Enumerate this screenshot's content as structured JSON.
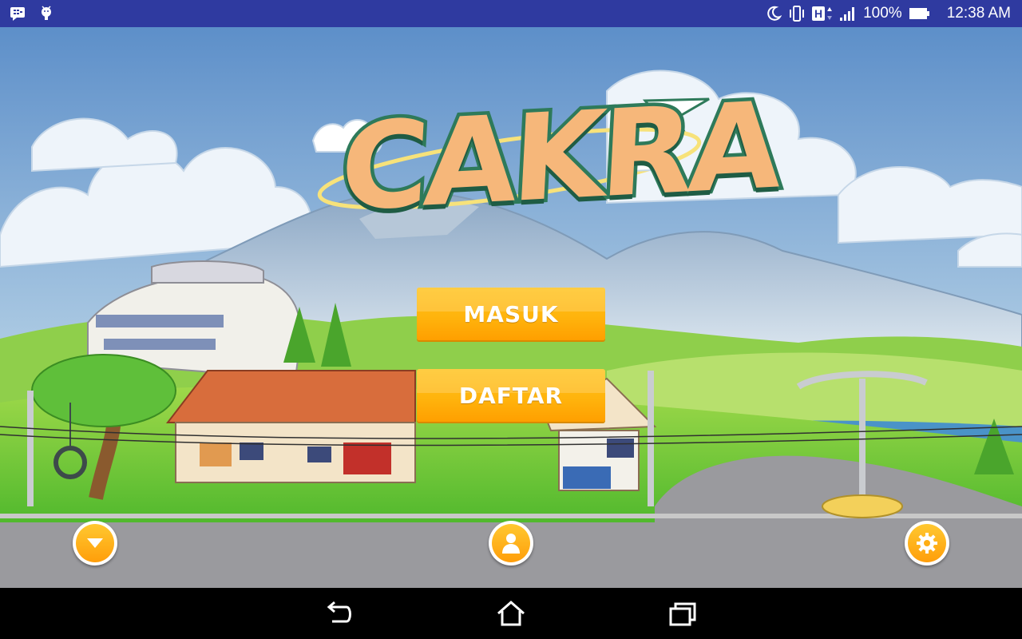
{
  "status_bar": {
    "battery_percent": "100%",
    "time": "12:38 AM",
    "network_type": "H",
    "icons": [
      "bbm-icon",
      "android-debug-icon",
      "moon-icon",
      "vibrate-icon",
      "network-h-icon",
      "signal-icon",
      "battery-icon"
    ]
  },
  "logo": {
    "text": "CAKRA"
  },
  "menu": {
    "masuk_label": "MASUK",
    "daftar_label": "DAFTAR"
  },
  "round_buttons": [
    "chevron-down-icon",
    "user-icon",
    "gear-icon"
  ],
  "nav_bar": [
    "back-icon",
    "home-icon",
    "recents-icon"
  ],
  "colors": {
    "status_bar": "#2f3aa0",
    "button_orange": "#ffb40d",
    "logo_fill": "#f6b77a",
    "logo_outline": "#2e7a5a"
  }
}
